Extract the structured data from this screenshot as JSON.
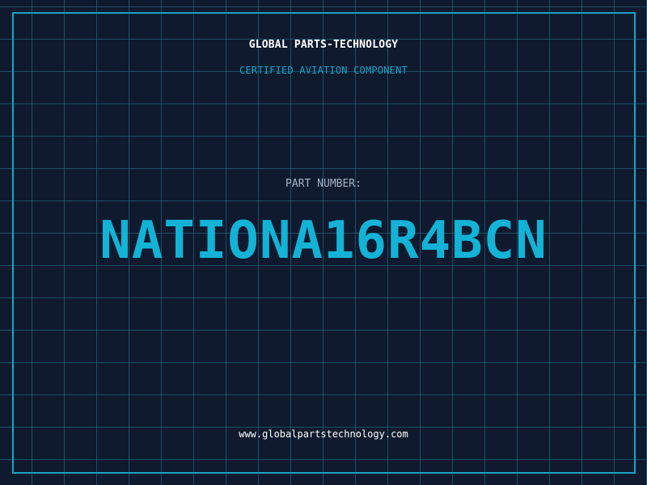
{
  "header": {
    "company": "GLOBAL PARTS-TECHNOLOGY",
    "tagline": "CERTIFIED AVIATION COMPONENT"
  },
  "part": {
    "label": "PART NUMBER:",
    "number": "NATIONA16R4BCN"
  },
  "footer": {
    "website": "www.globalpartstechnology.com"
  },
  "colors": {
    "background": "#0f1a2e",
    "grid": "#26788c",
    "accent": "#1aa3c7",
    "part_number": "#12b3d6",
    "text": "#ffffff",
    "label": "#a9b4c6"
  }
}
